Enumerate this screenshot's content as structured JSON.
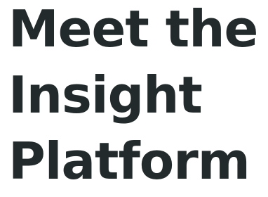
{
  "hero": {
    "lines": [
      "Meet the",
      "Insight",
      "Platform"
    ],
    "text_color": "#232a2c",
    "background_color": "#ffffff"
  }
}
